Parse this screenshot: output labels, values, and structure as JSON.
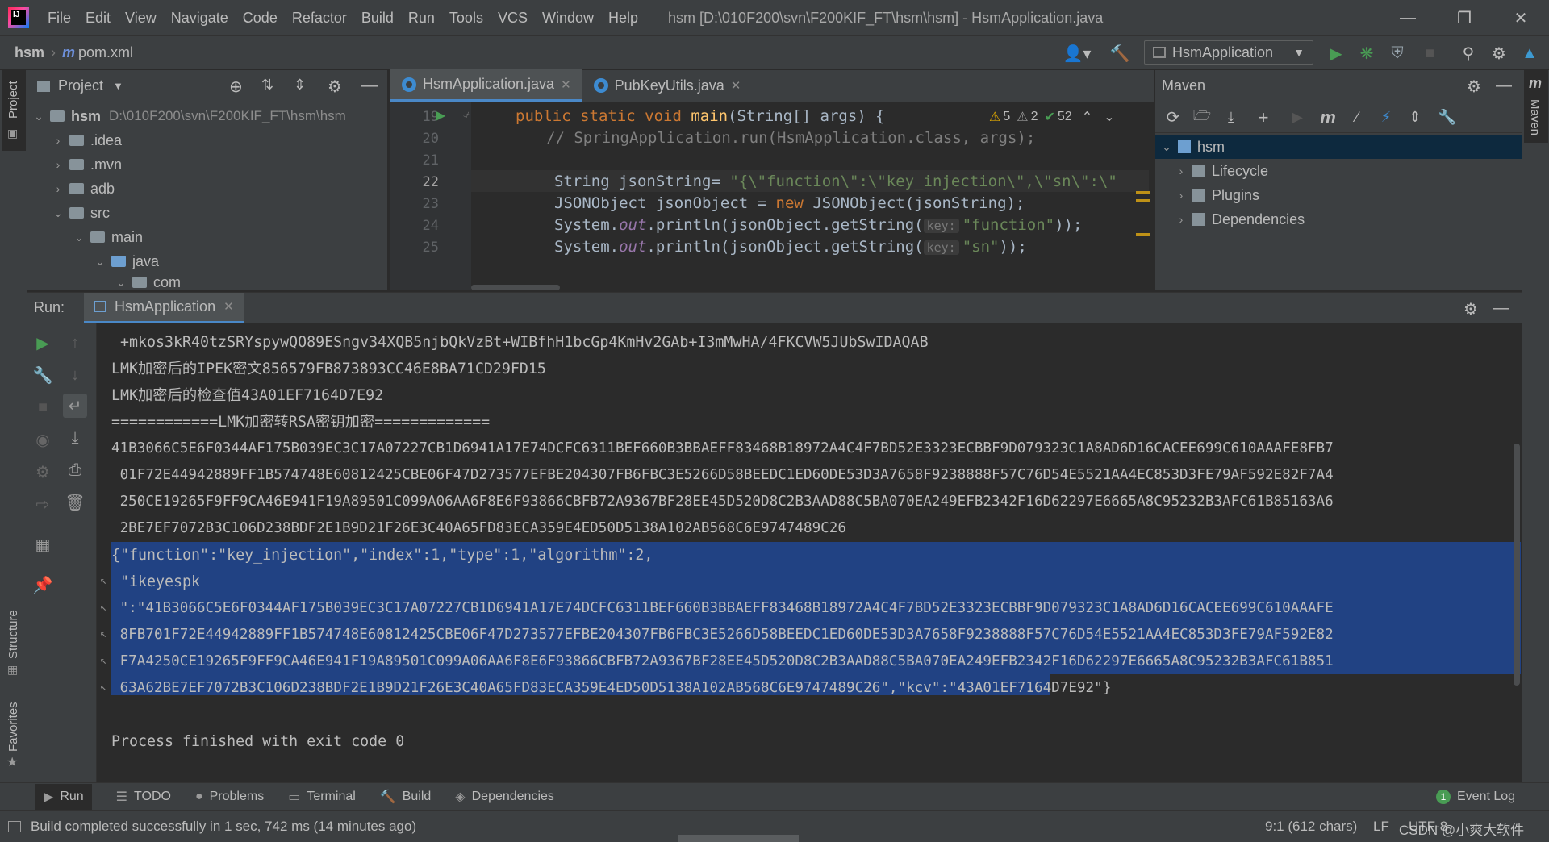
{
  "app": {
    "logo_text": "IJ",
    "window_title": "hsm [D:\\010F200\\svn\\F200KIF_FT\\hsm\\hsm] - HsmApplication.java"
  },
  "menu": [
    "File",
    "Edit",
    "View",
    "Navigate",
    "Code",
    "Refactor",
    "Build",
    "Run",
    "Tools",
    "VCS",
    "Window",
    "Help"
  ],
  "breadcrumb": {
    "project": "hsm",
    "file": "pom.xml"
  },
  "run_config": {
    "label": "HsmApplication"
  },
  "project_panel": {
    "title": "Project",
    "tree": [
      {
        "label": "hsm",
        "path": "D:\\010F200\\svn\\F200KIF_FT\\hsm\\hsm"
      },
      {
        "label": ".idea"
      },
      {
        "label": ".mvn"
      },
      {
        "label": "adb"
      },
      {
        "label": "src"
      },
      {
        "label": "main"
      },
      {
        "label": "java"
      },
      {
        "label": "com"
      }
    ]
  },
  "editor": {
    "tabs": [
      {
        "label": "HsmApplication.java",
        "active": true
      },
      {
        "label": "PubKeyUtils.java",
        "active": false
      }
    ],
    "inspections": {
      "warnings": "5",
      "weak_warnings": "2",
      "ok": "52"
    },
    "line_numbers": [
      "19",
      "20",
      "21",
      "22",
      "23",
      "24",
      "25"
    ],
    "lines": [
      {
        "kw": "public static void ",
        "fn": "main",
        "rest": "(String[] args) {"
      },
      {
        "comment": "// SpringApplication.run(HsmApplication.class, args);"
      },
      {
        "text": ""
      },
      {
        "pre": "String jsonString= ",
        "str": "\"{\\\"function\\\":\\\"key_injection\\\",\\\"sn\\\":\\\""
      },
      {
        "pre": "JSONObject jsonObject = ",
        "kw": "new ",
        "rest": "JSONObject(jsonString);"
      },
      {
        "pre": "System.",
        "fld": "out",
        "mid": ".println(jsonObject.getString(",
        "hint": "key:",
        "str": "\"function\"",
        "rest": "));"
      },
      {
        "pre": "System.",
        "fld": "out",
        "mid": ".println(jsonObject.getString(",
        "hint": "key:",
        "str": "\"sn\"",
        "rest": "));"
      }
    ]
  },
  "maven_panel": {
    "title": "Maven",
    "tree": [
      {
        "label": "hsm"
      },
      {
        "label": "Lifecycle"
      },
      {
        "label": "Plugins"
      },
      {
        "label": "Dependencies"
      }
    ]
  },
  "run_panel": {
    "title": "Run:",
    "tab": "HsmApplication",
    "console": [
      " +mkos3kR40tzSRYspywQO89ESngv34XQB5njbQkVzBt+WIBfhH1bcGp4KmHv2GAb+I3mMwHA/4FKCVW5JUbSwIDAQAB",
      "LMK加密后的IPEK密文856579FB873893CC46E8BA71CD29FD15",
      "LMK加密后的检查值43A01EF7164D7E92",
      "============LMK加密转RSA密钥加密=============",
      "41B3066C5E6F0344AF175B039EC3C17A07227CB1D6941A17E74DCFC6311BEF660B3BBAEFF83468B18972A4C4F7BD52E3323ECBBF9D079323C1A8AD6D16CACEE699C610AAAFE8FB7",
      " 01F72E44942889FF1B574748E60812425CBE06F47D273577EFBE204307FB6FBC3E5266D58BEEDC1ED60DE53D3A7658F9238888F57C76D54E5521AA4EC853D3FE79AF592E82F7A4",
      " 250CE19265F9FF9CA46E941F19A89501C099A06AA6F8E6F93866CBFB72A9367BF28EE45D520D8C2B3AAD88C5BA070EA249EFB2342F16D62297E6665A8C95232B3AFC61B85163A6",
      " 2BE7EF7072B3C106D238BDF2E1B9D21F26E3C40A65FD83ECA359E4ED50D5138A102AB568C6E9747489C26",
      "{\"function\":\"key_injection\",\"index\":1,\"type\":1,\"algorithm\":2,",
      " \"ikeyespk",
      " \":\"41B3066C5E6F0344AF175B039EC3C17A07227CB1D6941A17E74DCFC6311BEF660B3BBAEFF83468B18972A4C4F7BD52E3323ECBBF9D079323C1A8AD6D16CACEE699C610AAAFE",
      " 8FB701F72E44942889FF1B574748E60812425CBE06F47D273577EFBE204307FB6FBC3E5266D58BEEDC1ED60DE53D3A7658F9238888F57C76D54E5521AA4EC853D3FE79AF592E82",
      " F7A4250CE19265F9FF9CA46E941F19A89501C099A06AA6F8E6F93866CBFB72A9367BF28EE45D520D8C2B3AAD88C5BA070EA249EFB2342F16D62297E6665A8C95232B3AFC61B851",
      " 63A62BE7EF7072B3C106D238BDF2E1B9D21F26E3C40A65FD83ECA359E4ED50D5138A102AB568C6E9747489C26\",\"kcv\":\"43A01EF7164D7E92\"}",
      "",
      "Process finished with exit code 0"
    ]
  },
  "side_stripes": {
    "left_top": "Project",
    "left_mid": "Structure",
    "left_bottom": "Favorites",
    "right": "Maven"
  },
  "bottom_tabs": [
    "Run",
    "TODO",
    "Problems",
    "Terminal",
    "Build",
    "Dependencies"
  ],
  "event_log": {
    "count": "1",
    "label": "Event Log"
  },
  "status": {
    "message": "Build completed successfully in 1 sec, 742 ms (14 minutes ago)",
    "position": "9:1 (612 chars)",
    "line_sep": "LF",
    "encoding": "UTF-8",
    "watermark": "CSDN @小爽大软件"
  },
  "colors": {
    "accent": "#4a88c7",
    "selection": "#214283",
    "run_green": "#499c54",
    "keyword": "#cc7832",
    "string": "#6a8759"
  }
}
